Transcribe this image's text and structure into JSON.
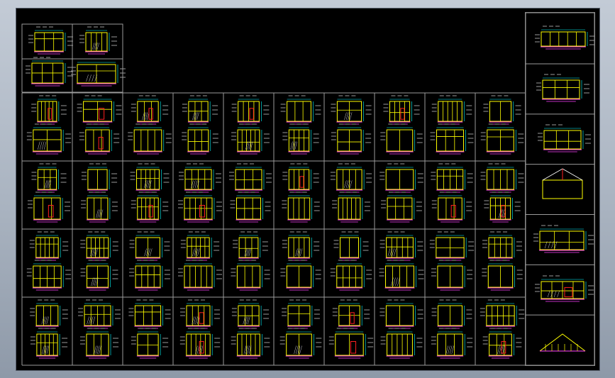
{
  "viewport": {
    "title": "",
    "background_gradient": [
      "#c3cbd6",
      "#8e99a8"
    ]
  },
  "sheet": {
    "background": "#000000",
    "frame_color": "#8a8a8a",
    "top_group": {
      "rows": 2,
      "cols": 2
    },
    "main_grid": {
      "rows": 4,
      "cols": 10,
      "views_per_cell": 2
    },
    "title_block": {
      "cells": 7
    }
  },
  "palette": {
    "outline": "#ffff00",
    "dimension": "#00ffff",
    "hatch": "#ffffff",
    "accent_red": "#ff2020",
    "accent_magenta": "#ff40ff",
    "note": "#9a9a9a"
  }
}
